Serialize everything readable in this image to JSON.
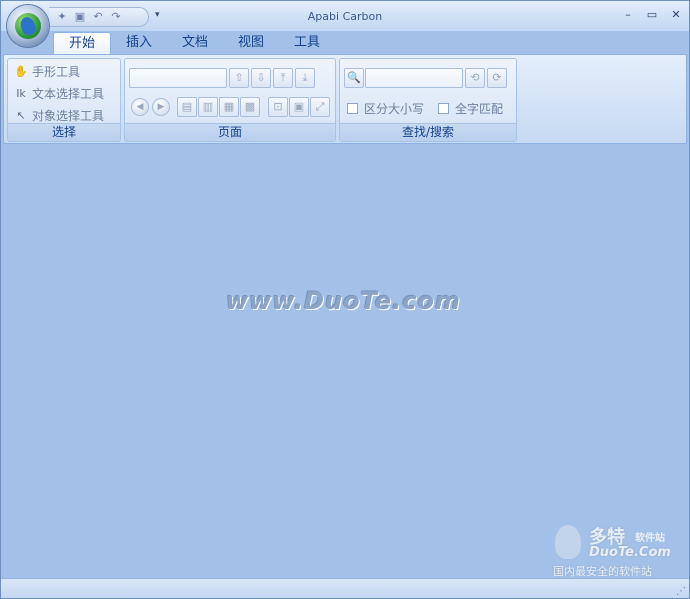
{
  "window": {
    "title": "Apabi Carbon",
    "minimize": "–",
    "restore": "▭",
    "close": "✕"
  },
  "qat": {
    "icons": [
      "open-icon",
      "save-icon",
      "undo-icon",
      "redo-icon"
    ],
    "more": "▾"
  },
  "tabs": [
    {
      "label": "开始",
      "active": true
    },
    {
      "label": "插入"
    },
    {
      "label": "文档"
    },
    {
      "label": "视图"
    },
    {
      "label": "工具"
    }
  ],
  "ribbon": {
    "select_group": {
      "label": "选择",
      "tools": [
        "手形工具",
        "文本选择工具",
        "对象选择工具"
      ]
    },
    "page_group": {
      "label": "页面",
      "page_input": "",
      "nav": [
        "⇧",
        "⇩",
        "⤒",
        "⤓"
      ],
      "back": "◀",
      "forward": "▶",
      "layout": [
        "▤",
        "▥",
        "▦",
        "▩"
      ],
      "zoom": [
        "⊡",
        "▣",
        "⤢"
      ]
    },
    "search_group": {
      "label": "查找/搜索",
      "search_input": "",
      "case_label": "区分大小写",
      "whole_label": "全字匹配"
    }
  },
  "watermark": {
    "text": "www.DuoTe.com",
    "logo_big": "多特",
    "logo_small": "软件站",
    "logo_site": "DuoTe.Com",
    "logo_slogan": "国内最安全的软件站"
  },
  "colors": {
    "accent": "#15428b",
    "workspace": "#a3c1e8",
    "border": "#8db2e3"
  }
}
